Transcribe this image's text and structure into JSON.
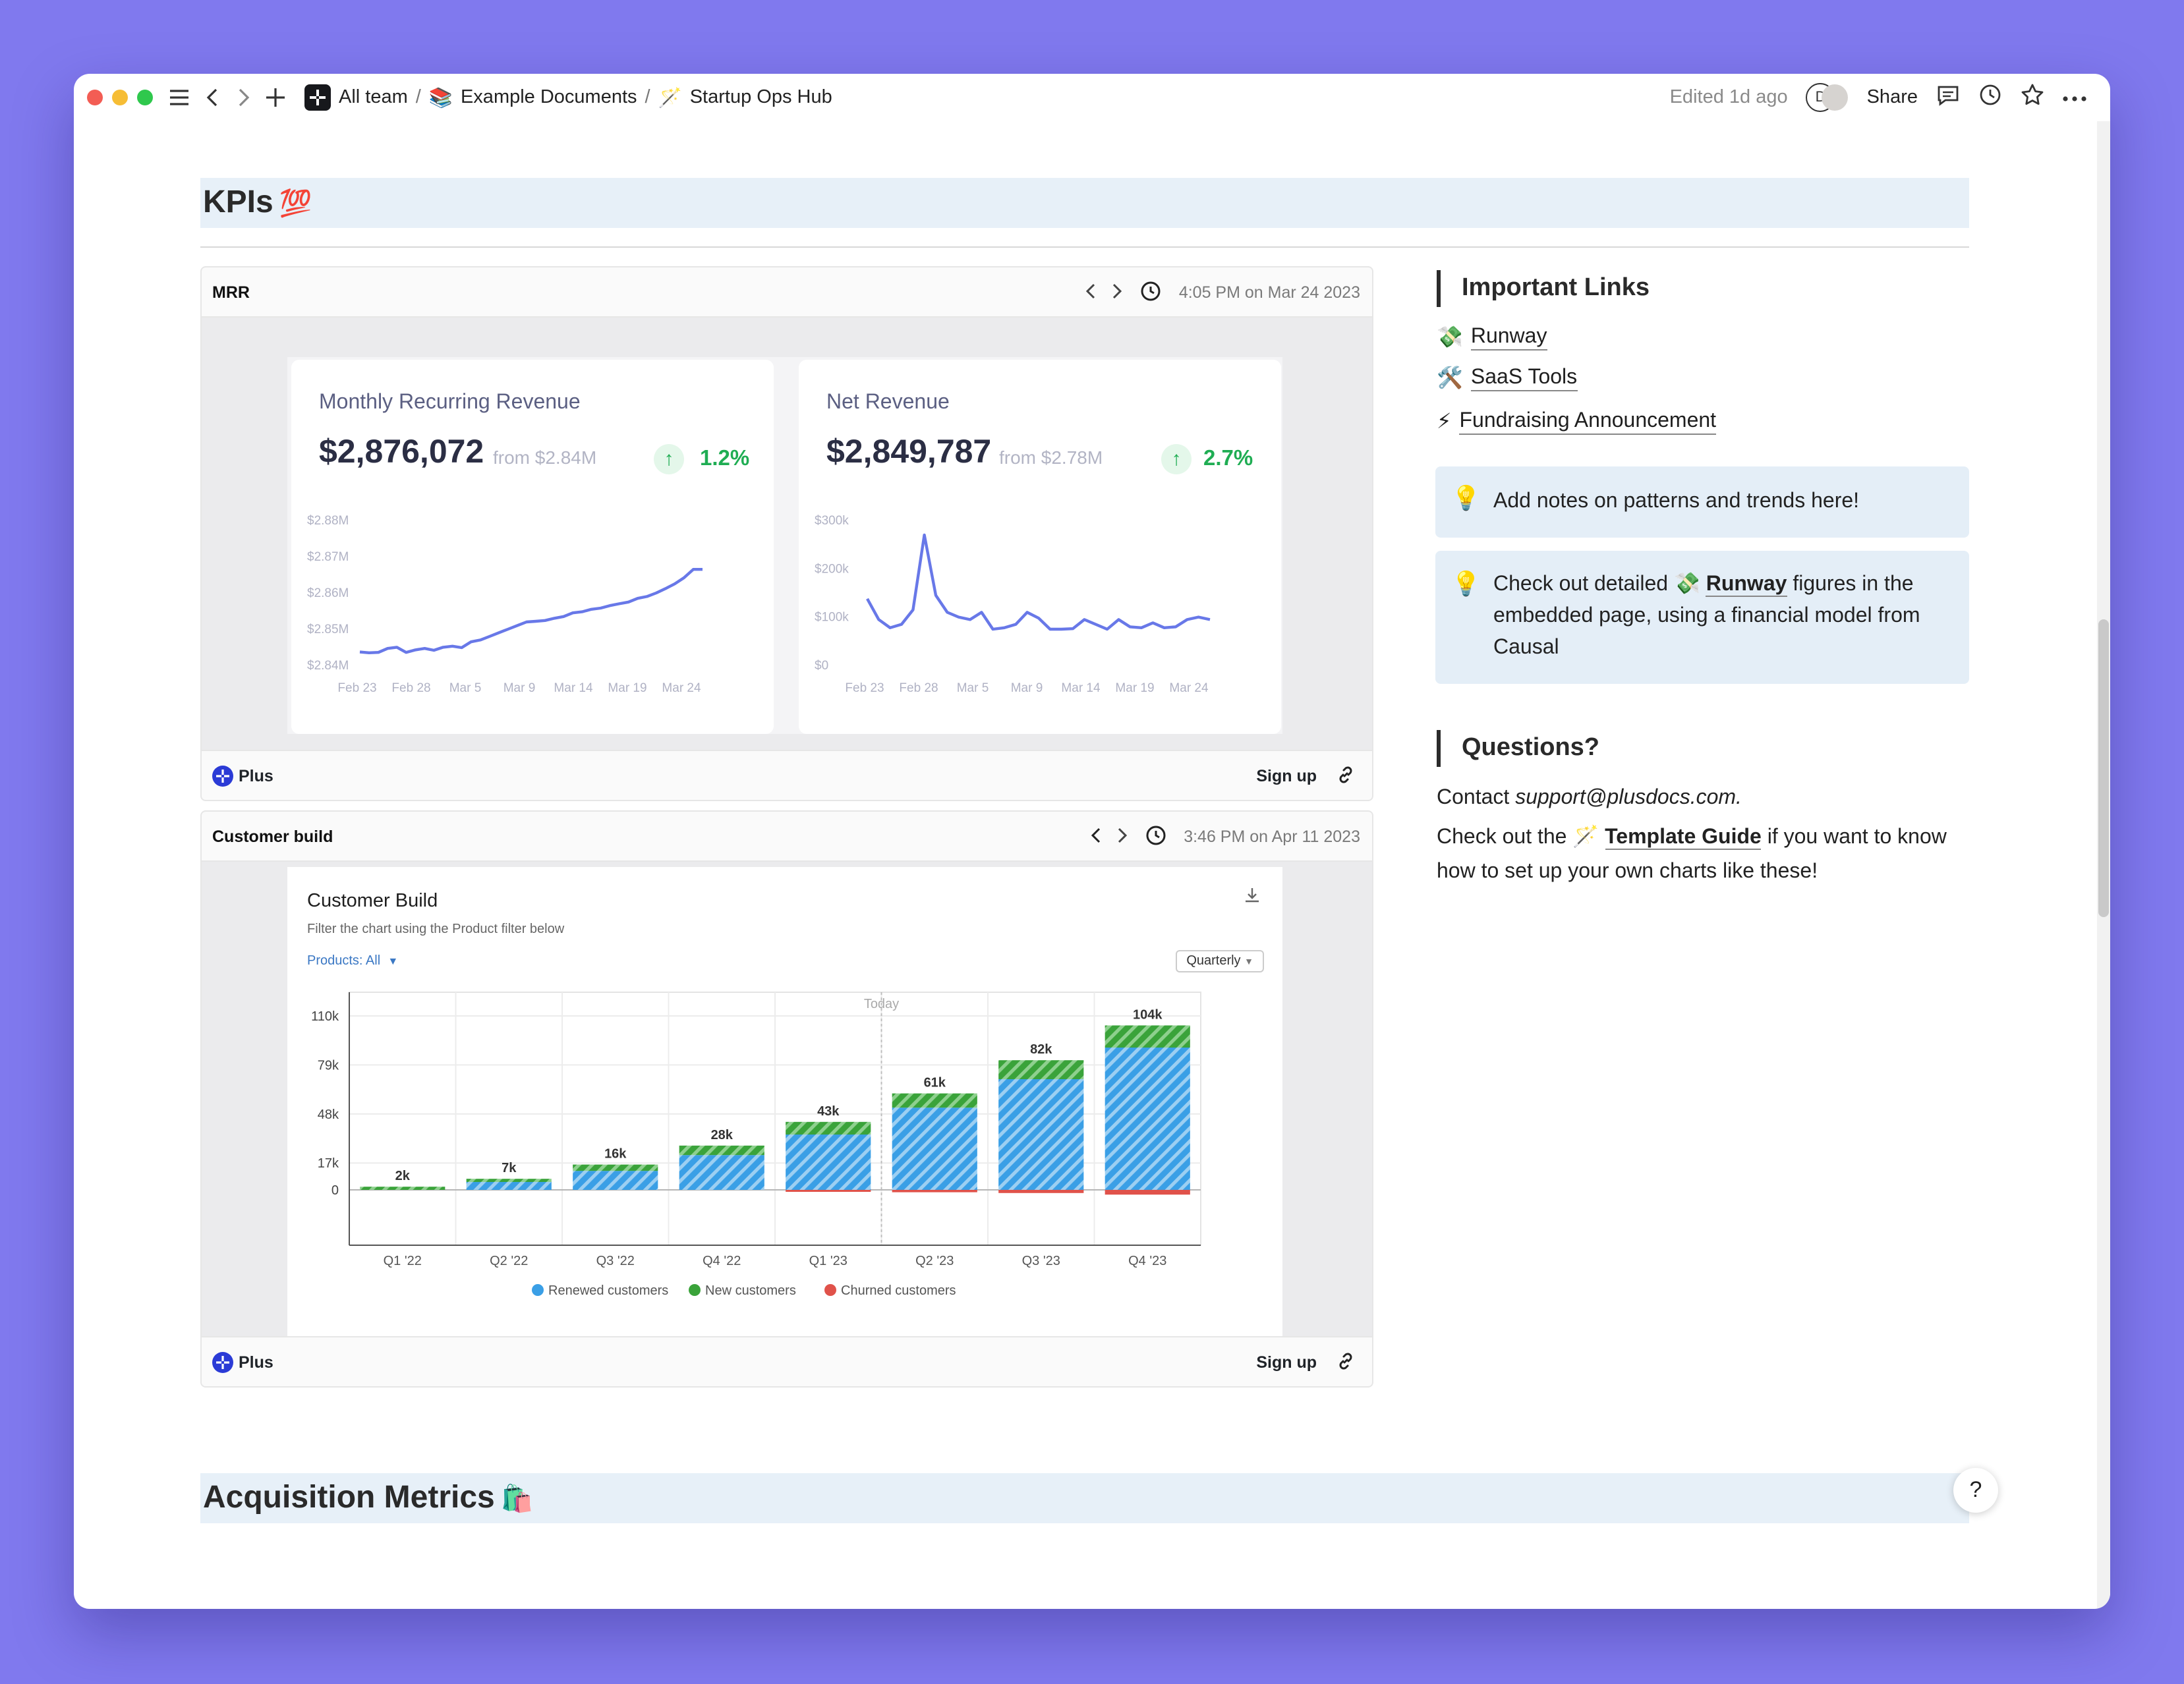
{
  "titlebar": {
    "breadcrumbs": [
      "All team",
      "Example Documents",
      "Startup Ops Hub"
    ],
    "edited": "Edited 1d ago",
    "avatar_initial": "D",
    "share": "Share"
  },
  "kpi_section": {
    "title": "KPIs",
    "emoji": "💯"
  },
  "acq_section": {
    "title": "Acquisition Metrics",
    "emoji": "🛍️"
  },
  "mrr_card": {
    "name": "MRR",
    "timestamp": "4:05 PM on Mar 24 2023",
    "footer_brand": "Plus",
    "signup": "Sign up",
    "mrr": {
      "title": "Monthly Recurring Revenue",
      "value": "$2,876,072",
      "from": "from $2.84M",
      "change": "1.2%"
    },
    "net": {
      "title": "Net Revenue",
      "value": "$2,849,787",
      "from": "from $2.78M",
      "change": "2.7%"
    }
  },
  "customer_card": {
    "name": "Customer build",
    "timestamp": "3:46 PM on Apr 11 2023",
    "footer_brand": "Plus",
    "signup": "Sign up",
    "chart_title": "Customer Build",
    "subtitle": "Filter the chart using the Product filter below",
    "filter": "Products: All",
    "granularity": "Quarterly",
    "today_label": "Today"
  },
  "sidebar": {
    "links_heading": "Important Links",
    "links": [
      {
        "emoji": "💸",
        "label": "Runway"
      },
      {
        "emoji": "🛠️",
        "label": "SaaS Tools"
      },
      {
        "emoji": "⚡",
        "label": "Fundraising Announcement"
      }
    ],
    "note1": "Add notes on patterns and trends here!",
    "note2_pre": "Check out detailed",
    "note2_link": "Runway",
    "note2_post": "figures in the embedded page, using a financial model from Causal",
    "questions_heading": "Questions?",
    "contact_pre": "Contact",
    "contact_email": "support@plusdocs.com.",
    "guide_pre": "Check out the",
    "guide_link": "Template Guide",
    "guide_post": "if you want to know how to set up your own charts like these!"
  },
  "help": "?",
  "colors": {
    "accent_line": "#6878e8",
    "renewed": "#3a9fe6",
    "new": "#3aa33a",
    "churned": "#e0524a",
    "positive": "#1fad53"
  },
  "chart_data": [
    {
      "type": "line",
      "title": "Monthly Recurring Revenue",
      "x_ticks": [
        "Feb 23",
        "Feb 28",
        "Mar 5",
        "Mar 9",
        "Mar 14",
        "Mar 19",
        "Mar 24"
      ],
      "y_ticks": [
        "$2.84M",
        "$2.85M",
        "$2.86M",
        "$2.87M",
        "$2.88M"
      ],
      "ylim": [
        2.84,
        2.88
      ],
      "series": [
        {
          "values": [
            2.8437,
            2.8435,
            2.8436,
            2.8447,
            2.845,
            2.8436,
            2.8443,
            2.8447,
            2.8442,
            2.845,
            2.8453,
            2.8449,
            2.8465,
            2.847,
            2.848,
            2.849,
            2.85,
            2.851,
            2.852,
            2.8522,
            2.8524,
            2.853,
            2.8535,
            2.8545,
            2.8548,
            2.8555,
            2.8558,
            2.8565,
            2.857,
            2.8575,
            2.8585,
            2.859,
            2.86,
            2.8612,
            2.8625,
            2.8642,
            2.8665,
            2.8665
          ]
        }
      ]
    },
    {
      "type": "line",
      "title": "Net Revenue",
      "x_ticks": [
        "Feb 23",
        "Feb 28",
        "Mar 5",
        "Mar 9",
        "Mar 14",
        "Mar 19",
        "Mar 24"
      ],
      "y_ticks": [
        "$0",
        "$100k",
        "$200k",
        "$300k"
      ],
      "ylim": [
        0,
        300
      ],
      "series": [
        {
          "values": [
            138,
            95,
            78,
            85,
            115,
            270,
            145,
            110,
            100,
            95,
            110,
            75,
            78,
            85,
            110,
            98,
            75,
            75,
            76,
            95,
            85,
            75,
            95,
            80,
            78,
            88,
            78,
            80,
            95,
            100,
            95
          ]
        }
      ]
    },
    {
      "type": "bar",
      "title": "Customer Build",
      "categories": [
        "Q1 '22",
        "Q2 '22",
        "Q3 '22",
        "Q4 '22",
        "Q1 '23",
        "Q2 '23",
        "Q3 '23",
        "Q4 '23"
      ],
      "y_ticks": [
        "0",
        "17k",
        "48k",
        "79k",
        "110k"
      ],
      "ylim": [
        -35,
        125
      ],
      "totals": [
        "2k",
        "7k",
        "16k",
        "28k",
        "43k",
        "61k",
        "82k",
        "104k"
      ],
      "series": [
        {
          "name": "Renewed customers",
          "values": [
            0,
            5,
            12,
            22,
            35,
            52,
            70,
            90
          ]
        },
        {
          "name": "New customers",
          "values": [
            2,
            2,
            4,
            6,
            8,
            9,
            12,
            14
          ]
        },
        {
          "name": "Churned customers",
          "values": [
            0,
            0,
            0,
            0,
            -1,
            -1.5,
            -2,
            -3
          ]
        }
      ],
      "today_after": "Q1 '23"
    }
  ]
}
